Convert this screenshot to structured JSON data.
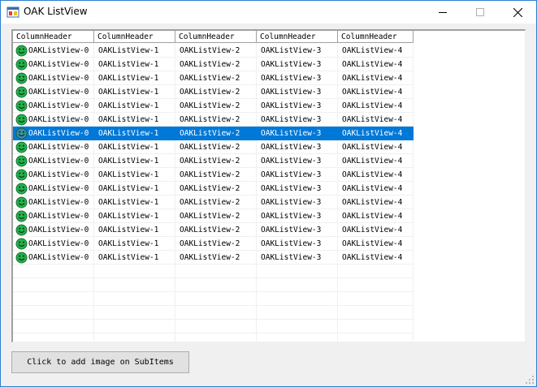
{
  "window": {
    "title": "OAK ListView",
    "icon": "app-window-icon",
    "controls": {
      "minimize": "minimize-icon",
      "maximize": "maximize-icon",
      "close": "close-icon"
    }
  },
  "listview": {
    "columns": [
      "ColumnHeader",
      "ColumnHeader",
      "ColumnHeader",
      "ColumnHeader",
      "ColumnHeader"
    ],
    "row_icon": "green-smiley-icon",
    "selected_row": 6,
    "rows": [
      [
        "OAKListView-0",
        "OAKListView-1",
        "OAKListView-2",
        "OAKListView-3",
        "OAKListView-4"
      ],
      [
        "OAKListView-0",
        "OAKListView-1",
        "OAKListView-2",
        "OAKListView-3",
        "OAKListView-4"
      ],
      [
        "OAKListView-0",
        "OAKListView-1",
        "OAKListView-2",
        "OAKListView-3",
        "OAKListView-4"
      ],
      [
        "OAKListView-0",
        "OAKListView-1",
        "OAKListView-2",
        "OAKListView-3",
        "OAKListView-4"
      ],
      [
        "OAKListView-0",
        "OAKListView-1",
        "OAKListView-2",
        "OAKListView-3",
        "OAKListView-4"
      ],
      [
        "OAKListView-0",
        "OAKListView-1",
        "OAKListView-2",
        "OAKListView-3",
        "OAKListView-4"
      ],
      [
        "OAKListView-0",
        "OAKListView-1",
        "OAKListView-2",
        "OAKListView-3",
        "OAKListView-4"
      ],
      [
        "OAKListView-0",
        "OAKListView-1",
        "OAKListView-2",
        "OAKListView-3",
        "OAKListView-4"
      ],
      [
        "OAKListView-0",
        "OAKListView-1",
        "OAKListView-2",
        "OAKListView-3",
        "OAKListView-4"
      ],
      [
        "OAKListView-0",
        "OAKListView-1",
        "OAKListView-2",
        "OAKListView-3",
        "OAKListView-4"
      ],
      [
        "OAKListView-0",
        "OAKListView-1",
        "OAKListView-2",
        "OAKListView-3",
        "OAKListView-4"
      ],
      [
        "OAKListView-0",
        "OAKListView-1",
        "OAKListView-2",
        "OAKListView-3",
        "OAKListView-4"
      ],
      [
        "OAKListView-0",
        "OAKListView-1",
        "OAKListView-2",
        "OAKListView-3",
        "OAKListView-4"
      ],
      [
        "OAKListView-0",
        "OAKListView-1",
        "OAKListView-2",
        "OAKListView-3",
        "OAKListView-4"
      ],
      [
        "OAKListView-0",
        "OAKListView-1",
        "OAKListView-2",
        "OAKListView-3",
        "OAKListView-4"
      ],
      [
        "OAKListView-0",
        "OAKListView-1",
        "OAKListView-2",
        "OAKListView-3",
        "OAKListView-4"
      ]
    ]
  },
  "actions": {
    "add_image_label": "Click to add image on SubItems"
  },
  "colors": {
    "selection": "#0078d7",
    "window_border": "#2d7fd1",
    "grid_line": "#f0f0f0",
    "smiley_fill": "#22b14c"
  }
}
